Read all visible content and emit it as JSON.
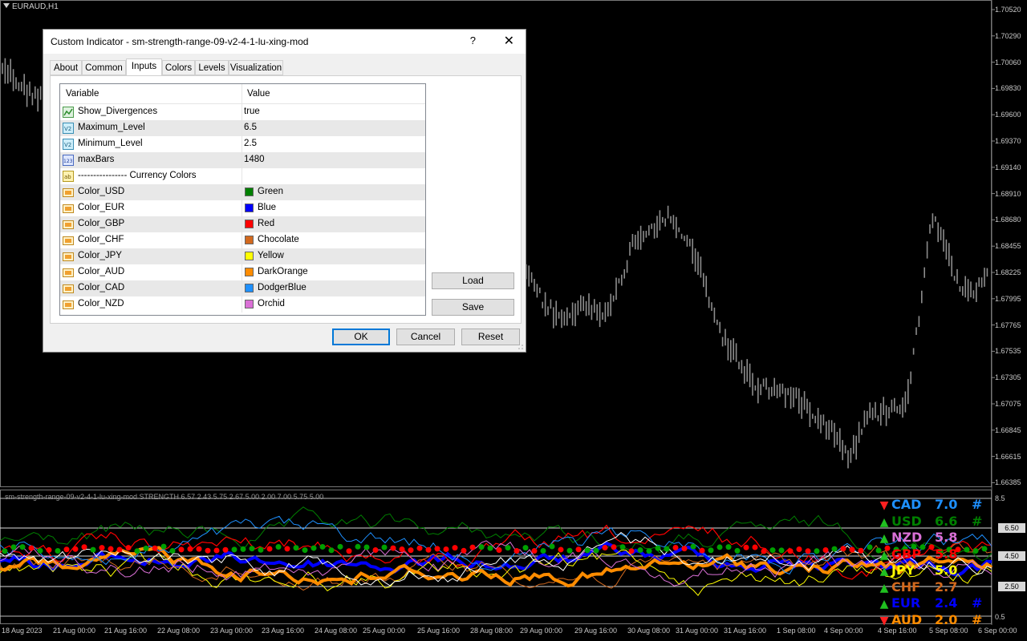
{
  "symbol_title": "EURAUD,H1",
  "indicator_title": "sm-strength-range-09-v2-4-1-lu-xing-mod STRENGTH  6.57 2.43 5.75 2.67 5.00 2.00 7.00 5.75 5.00",
  "price_scale": [
    "1.70520",
    "1.70290",
    "1.70060",
    "1.69830",
    "1.69600",
    "1.69370",
    "1.69140",
    "1.68910",
    "1.68680",
    "1.68455",
    "1.68225",
    "1.67995",
    "1.67765",
    "1.67535",
    "1.67305",
    "1.67075",
    "1.66845",
    "1.66615",
    "1.66385"
  ],
  "indicator_scale": {
    "top": "8.5",
    "l650": "6.50",
    "l450": "4.50",
    "l250": "2.50",
    "bottom": "0.5"
  },
  "time_labels": [
    "18 Aug 2023",
    "21 Aug 00:00",
    "21 Aug 16:00",
    "22 Aug 08:00",
    "23 Aug 00:00",
    "23 Aug 16:00",
    "24 Aug 08:00",
    "25 Aug 00:00",
    "25 Aug 16:00",
    "28 Aug 08:00",
    "29 Aug 00:00",
    "29 Aug 16:00",
    "30 Aug 08:00",
    "31 Aug 00:00",
    "31 Aug 16:00",
    "1 Sep 08:00",
    "4 Sep 00:00",
    "4 Sep 16:00",
    "5 Sep 08:00",
    "6 Sep 00:00"
  ],
  "currency_list": [
    {
      "arrow": "▼",
      "arrow_color": "#ff2020",
      "code": "CAD",
      "value": "7.0",
      "hash": "#",
      "color": "#1e90ff"
    },
    {
      "arrow": "▲",
      "arrow_color": "#20c020",
      "code": "USD",
      "value": "6.6",
      "hash": "#",
      "color": "#008000"
    },
    {
      "arrow": "▲",
      "arrow_color": "#20c020",
      "code": "NZD",
      "value": "5.8",
      "hash": "",
      "color": "#da70d6"
    },
    {
      "arrow": "▲",
      "arrow_color": "#20c020",
      "code": "GBP",
      "value": "5.8",
      "hash": "",
      "color": "#ff0000"
    },
    {
      "arrow": "▲",
      "arrow_color": "#20c020",
      "code": "JPY",
      "value": "5.0",
      "hash": "",
      "color": "#ffff00"
    },
    {
      "arrow": "▲",
      "arrow_color": "#20c020",
      "code": "CHF",
      "value": "2.7",
      "hash": "",
      "color": "#d2691e"
    },
    {
      "arrow": "▲",
      "arrow_color": "#20c020",
      "code": "EUR",
      "value": "2.4",
      "hash": "#",
      "color": "#0000ff"
    },
    {
      "arrow": "▼",
      "arrow_color": "#ff2020",
      "code": "AUD",
      "value": "2.0",
      "hash": "#",
      "color": "#ff8c00"
    }
  ],
  "dialog": {
    "title": "Custom Indicator - sm-strength-range-09-v2-4-1-lu-xing-mod",
    "help": "?",
    "close": "✕",
    "tabs": [
      "About",
      "Common",
      "Inputs",
      "Colors",
      "Levels",
      "Visualization"
    ],
    "active_tab": "Inputs",
    "col_variable": "Variable",
    "col_value": "Value",
    "rows": [
      {
        "icon": "chart",
        "variable": "Show_Divergences",
        "value": "true"
      },
      {
        "icon": "v2",
        "variable": "Maximum_Level",
        "value": "6.5"
      },
      {
        "icon": "v2",
        "variable": "Minimum_Level",
        "value": "2.5"
      },
      {
        "icon": "123",
        "variable": "maxBars",
        "value": "1480"
      },
      {
        "icon": "ab",
        "variable": "---------------- Currency Colors",
        "value": ""
      },
      {
        "icon": "color",
        "variable": "Color_USD",
        "value": "Green",
        "swatch": "#008000"
      },
      {
        "icon": "color",
        "variable": "Color_EUR",
        "value": "Blue",
        "swatch": "#0000ff"
      },
      {
        "icon": "color",
        "variable": "Color_GBP",
        "value": "Red",
        "swatch": "#ff0000"
      },
      {
        "icon": "color",
        "variable": "Color_CHF",
        "value": "Chocolate",
        "swatch": "#d2691e"
      },
      {
        "icon": "color",
        "variable": "Color_JPY",
        "value": "Yellow",
        "swatch": "#ffff00"
      },
      {
        "icon": "color",
        "variable": "Color_AUD",
        "value": "DarkOrange",
        "swatch": "#ff8c00"
      },
      {
        "icon": "color",
        "variable": "Color_CAD",
        "value": "DodgerBlue",
        "swatch": "#1e90ff"
      },
      {
        "icon": "color",
        "variable": "Color_NZD",
        "value": "Orchid",
        "swatch": "#da70d6"
      }
    ],
    "load": "Load",
    "save": "Save",
    "ok": "OK",
    "cancel": "Cancel",
    "reset": "Reset"
  }
}
